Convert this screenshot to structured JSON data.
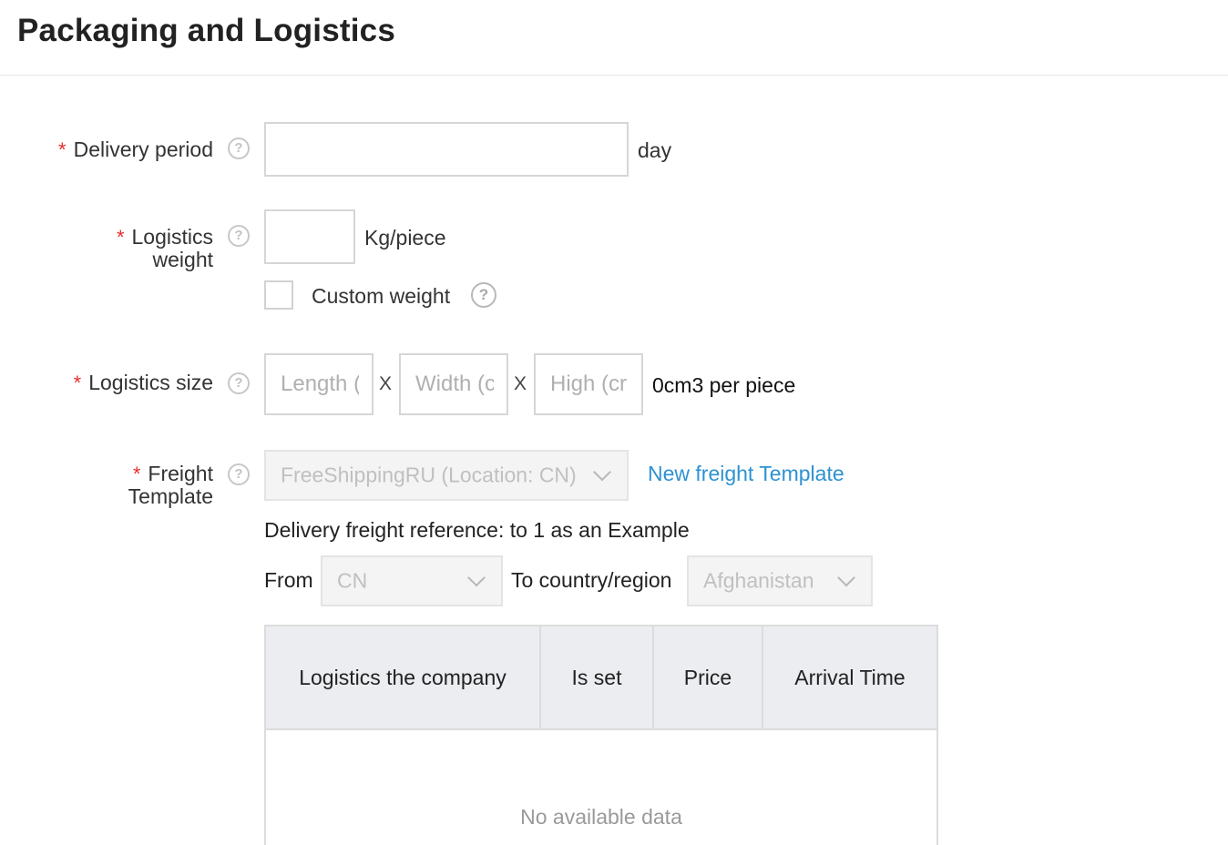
{
  "header": {
    "title": "Packaging and Logistics"
  },
  "form": {
    "required_mark": "*",
    "help_glyph": "?",
    "delivery_period": {
      "label": "Delivery period",
      "value": "",
      "unit": "day"
    },
    "logistics_weight": {
      "label_line1": "Logistics",
      "label_line2": "weight",
      "value": "",
      "unit": "Kg/piece",
      "custom_weight_label": "Custom weight",
      "custom_weight_checked": false
    },
    "logistics_size": {
      "label": "Logistics size",
      "length_placeholder": "Length (",
      "width_placeholder": "Width (c",
      "height_placeholder": "High (cr",
      "separator": "X",
      "volume_text": "0cm3 per piece"
    },
    "freight_template": {
      "label_line1": "Freight",
      "label_line2": "Template",
      "selected": "FreeShippingRU (Location: CN)",
      "new_link": "New freight Template"
    },
    "freight_reference": {
      "text": "Delivery freight reference: to 1 as an Example",
      "from_label": "From",
      "from_value": "CN",
      "to_label": "To country/region",
      "to_value": "Afghanistan"
    },
    "table": {
      "columns": [
        "Logistics the company",
        "Is set",
        "Price",
        "Arrival Time"
      ],
      "rows": [],
      "empty_text": "No available data"
    }
  },
  "colors": {
    "required": "#e62e2e",
    "link": "#2d92d2",
    "table_header_bg": "#ebedf0"
  }
}
